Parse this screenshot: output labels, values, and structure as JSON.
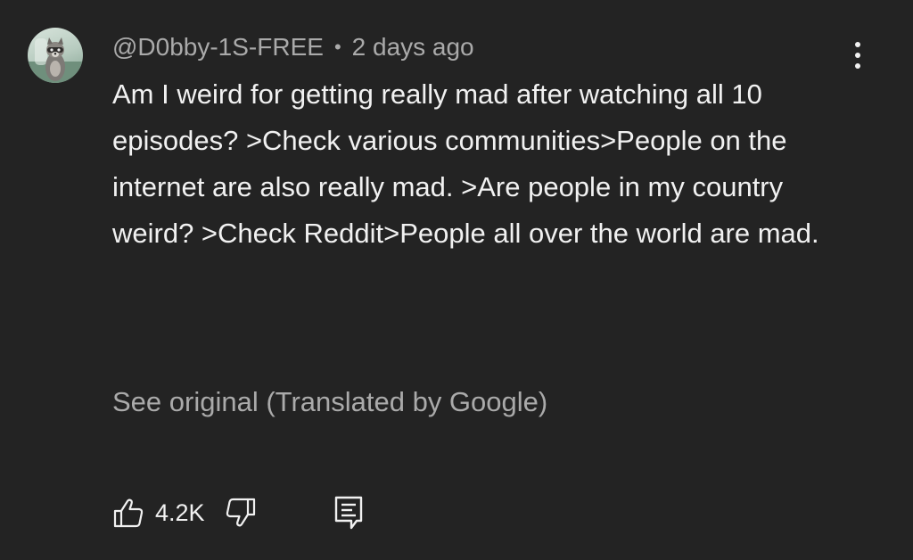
{
  "comment": {
    "avatar_icon": "raccoon-avatar",
    "author": "@D0bby-1S-FREE",
    "separator": "•",
    "timestamp": "2 days ago",
    "menu_icon": "more-vertical-icon",
    "text": "Am I weird for getting really mad after watching all 10 episodes? >Check various communities>People on the internet are also really mad. >Are people in my country weird? >Check Reddit>People all over the world are mad.",
    "translation_link": "See original (Translated by Google)",
    "like_count": "4.2K",
    "icons": {
      "like": "thumbs-up-icon",
      "dislike": "thumbs-down-icon",
      "reply": "reply-icon"
    }
  },
  "colors": {
    "background": "#232323",
    "primary_text": "#f1f1f1",
    "secondary_text": "#aaaaaa"
  }
}
